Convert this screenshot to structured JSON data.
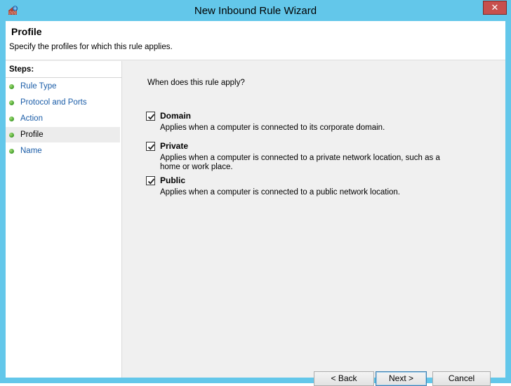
{
  "window": {
    "title": "New Inbound Rule Wizard",
    "close_glyph": "✕"
  },
  "header": {
    "title": "Profile",
    "description": "Specify the profiles for which this rule applies."
  },
  "steps": {
    "title": "Steps:",
    "items": [
      {
        "label": "Rule Type"
      },
      {
        "label": "Protocol and Ports"
      },
      {
        "label": "Action"
      },
      {
        "label": "Profile"
      },
      {
        "label": "Name"
      }
    ],
    "active_index": 3
  },
  "main": {
    "question": "When does this rule apply?",
    "options": [
      {
        "label": "Domain",
        "checked": true,
        "description": "Applies when a computer is connected to its corporate domain."
      },
      {
        "label": "Private",
        "checked": true,
        "description": "Applies when a computer is connected to a private network location, such as a home or work place."
      },
      {
        "label": "Public",
        "checked": true,
        "description": "Applies when a computer is connected to a public network location."
      }
    ]
  },
  "buttons": {
    "back": "< Back",
    "next": "Next >",
    "cancel": "Cancel"
  },
  "icons": {
    "app": "firewall-icon",
    "close": "close-icon",
    "step_bullet": "green-dot-icon",
    "check": "checkmark-icon"
  },
  "colors": {
    "titlebar": "#63c7ea",
    "close_button": "#c7504d",
    "link": "#1b5da8",
    "step_dot": "#4aa531"
  }
}
